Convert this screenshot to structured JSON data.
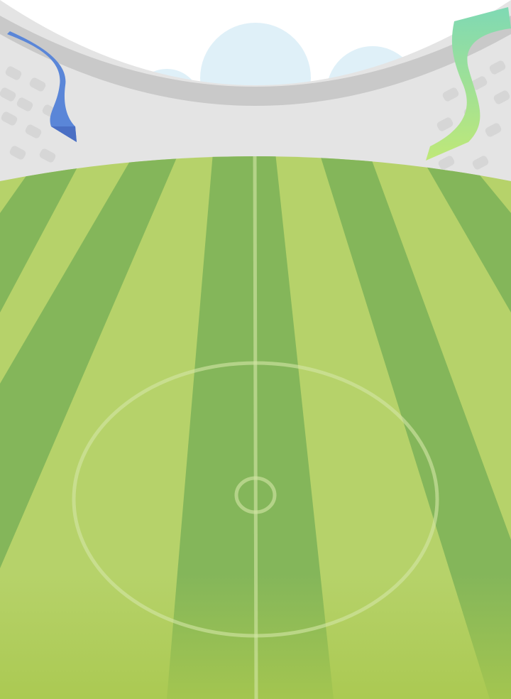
{
  "scene": {
    "type": "soccer-stadium-background",
    "elements": [
      "sky",
      "clouds",
      "stadium-stand",
      "banner-blue",
      "banner-green",
      "pitch",
      "halfway-line",
      "center-circle",
      "center-spot"
    ]
  },
  "colors": {
    "sky": "#ffffff",
    "cloud": "#dff0f8",
    "stand_face": "#e4e4e4",
    "stand_rim": "#c9c9c9",
    "seat": "#d6d6d6",
    "banner_blue": "#5a86d8",
    "banner_blue_shade": "#4a6fc4",
    "banner_green_top": "#7fd9b4",
    "banner_green_bottom": "#bfe878",
    "pitch_light": "#b6d26a",
    "pitch_dark": "#84b65a",
    "pitch_bottom": "#a9c84e",
    "line": "#d4e6a6"
  },
  "icons": {
    "banner_left": "ribbon-icon",
    "banner_right": "ribbon-icon"
  }
}
